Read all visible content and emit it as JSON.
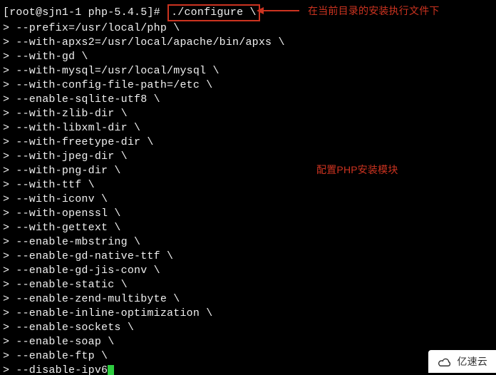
{
  "prompt": {
    "open": "[",
    "user_host": "root@sjn1-1",
    "dir": "php-5.4.5",
    "close": "]",
    "hash": "#"
  },
  "command": "./configure \\",
  "lines": [
    "--prefix=/usr/local/php \\",
    "--with-apxs2=/usr/local/apache/bin/apxs \\",
    "--with-gd \\",
    "--with-mysql=/usr/local/mysql \\",
    "--with-config-file-path=/etc \\",
    "--enable-sqlite-utf8 \\",
    "--with-zlib-dir \\",
    "--with-libxml-dir \\",
    "--with-freetype-dir \\",
    "--with-jpeg-dir \\",
    "--with-png-dir \\",
    "--with-ttf \\",
    "--with-iconv \\",
    "--with-openssl \\",
    "--with-gettext \\",
    "--enable-mbstring \\",
    "--enable-gd-native-ttf \\",
    "--enable-gd-jis-conv \\",
    "--enable-static \\",
    "--enable-zend-multibyte \\",
    "--enable-inline-optimization \\",
    "--enable-sockets \\",
    "--enable-soap \\",
    "--enable-ftp \\",
    "--disable-ipv6"
  ],
  "cont_prefix": "> ",
  "annotation_top": "在当前目录的安装执行文件下",
  "annotation_mid": "配置PHP安装模块",
  "watermark": "亿速云",
  "colors": {
    "bg": "#000000",
    "fg": "#f0f0f0",
    "highlight": "#cc3320",
    "cursor": "#2ecc40"
  }
}
